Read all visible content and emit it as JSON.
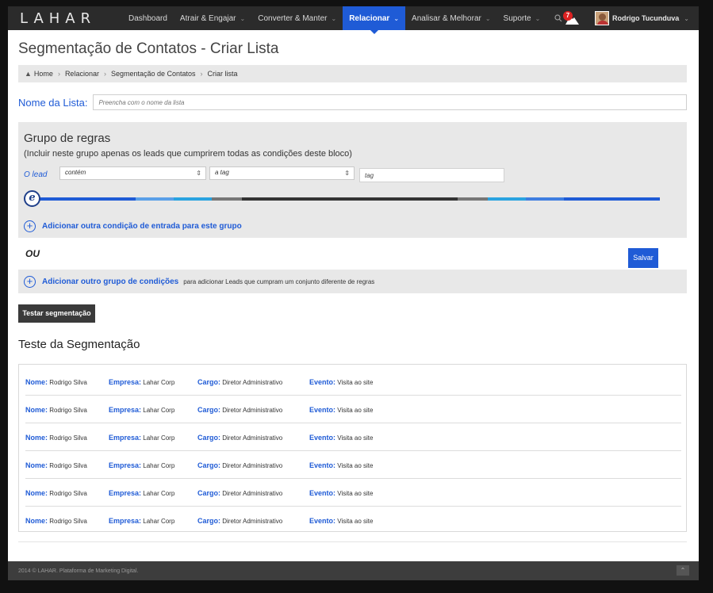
{
  "app": {
    "logo": "LAHAR"
  },
  "nav": {
    "items": [
      {
        "label": "Dashboard",
        "has_chevron": false
      },
      {
        "label": "Atrair & Engajar",
        "has_chevron": true
      },
      {
        "label": "Converter & Manter",
        "has_chevron": true
      },
      {
        "label": "Relacionar",
        "has_chevron": true,
        "active": true
      },
      {
        "label": "Analisar & Melhorar",
        "has_chevron": true
      },
      {
        "label": "Suporte",
        "has_chevron": true
      }
    ],
    "notification_count": "7",
    "user_name": "Rodrigo Tucunduva"
  },
  "page": {
    "title": "Segmentação de Contatos - Criar Lista"
  },
  "breadcrumb": {
    "items": [
      "Home",
      "Relacionar",
      "Segmentação de Contatos",
      "Criar lista"
    ]
  },
  "list_name": {
    "label": "Nome da Lista:",
    "placeholder": "Preencha com o nome da lista"
  },
  "rules": {
    "title": "Grupo de regras",
    "subtitle": "(Incluir neste grupo apenas os leads que cumprirem todas as condições deste bloco)",
    "lead_label": "O lead",
    "operator_value": "contém",
    "field_value": "a tag",
    "tag_placeholder": "tag",
    "e_label": "e",
    "add_condition": "Adicionar outra condição de entrada para este grupo"
  },
  "ou_label": "OU",
  "save_label": "Salvar",
  "add_group": {
    "label": "Adicionar outro grupo de condições",
    "note": "para adicionar Leads que cumpram um conjunto diferente de regras"
  },
  "test_button": "Testar segmentação",
  "test_title": "Teste da Segmentação",
  "results": {
    "labels": {
      "name": "Nome:",
      "company": "Empresa:",
      "role": "Cargo:",
      "event": "Evento:"
    },
    "rows": [
      {
        "name": "Rodrigo Silva",
        "company": "Lahar Corp",
        "role": "Diretor Administrativo",
        "event": "Visita ao site"
      },
      {
        "name": "Rodrigo Silva",
        "company": "Lahar Corp",
        "role": "Diretor Administrativo",
        "event": "Visita ao site"
      },
      {
        "name": "Rodrigo Silva",
        "company": "Lahar Corp",
        "role": "Diretor Administrativo",
        "event": "Visita ao site"
      },
      {
        "name": "Rodrigo Silva",
        "company": "Lahar Corp",
        "role": "Diretor Administrativo",
        "event": "Visita ao site"
      },
      {
        "name": "Rodrigo Silva",
        "company": "Lahar Corp",
        "role": "Diretor Administrativo",
        "event": "Visita ao site"
      },
      {
        "name": "Rodrigo Silva",
        "company": "Lahar Corp",
        "role": "Diretor Administrativo",
        "event": "Visita ao site"
      }
    ]
  },
  "footer": {
    "text": "2014 © LAHAR. Plataforma de Marketing Digital."
  },
  "colors": {
    "accent": "#1f5bd6",
    "nav_bg": "#2b2b2b",
    "panel_bg": "#e8e8e8",
    "color_bar": [
      "#1f5bd6",
      "#5aa0e8",
      "#2aa3e0",
      "#777777",
      "#333333",
      "#333333",
      "#777777",
      "#2aa3e0",
      "#1f5bd6",
      "#1f5bd6"
    ]
  }
}
